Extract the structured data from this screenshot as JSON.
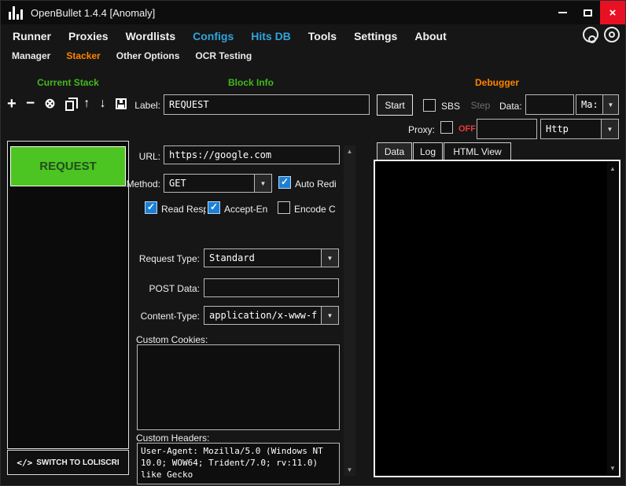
{
  "colors": {
    "accent_blue": "#2fa4dc",
    "accent_orange": "#ff8400",
    "accent_green": "#43b81e",
    "block_green": "#4cc421",
    "check_blue": "#1d7fd4",
    "off_red": "#eb3b3b",
    "close_red": "#e81123"
  },
  "icons": {
    "close": "×",
    "caret_down": "▼",
    "scroll_up": "▲",
    "scroll_down": "▼",
    "plus": "+",
    "minus": "−",
    "clear": "⊗",
    "up": "↑",
    "down": "↓"
  },
  "window": {
    "title": "OpenBullet 1.4.4 [Anomaly]"
  },
  "menu": {
    "items": [
      {
        "label": "Runner"
      },
      {
        "label": "Proxies"
      },
      {
        "label": "Wordlists"
      },
      {
        "label": "Configs"
      },
      {
        "label": "Hits DB"
      },
      {
        "label": "Tools"
      },
      {
        "label": "Settings"
      },
      {
        "label": "About"
      }
    ]
  },
  "submenu": {
    "items": [
      {
        "label": "Manager"
      },
      {
        "label": "Stacker"
      },
      {
        "label": "Other Options"
      },
      {
        "label": "OCR Testing"
      }
    ]
  },
  "stack": {
    "title": "Current Stack",
    "block_label": "REQUEST",
    "switch_icon": "</>",
    "switch_label": "SWITCH TO LOLISCRI"
  },
  "block_info": {
    "title": "Block Info",
    "label_field": {
      "label": "Label:",
      "value": "REQUEST"
    },
    "url": {
      "label": "URL:",
      "value": "https://google.com"
    },
    "method": {
      "label": "Method:",
      "value": "GET"
    },
    "auto_redirect": {
      "label": "Auto Redi",
      "checked": true
    },
    "read_response": {
      "label": "Read Resp",
      "checked": true
    },
    "accept_encoding": {
      "label": "Accept-En",
      "checked": true
    },
    "encode_content": {
      "label": "Encode C",
      "checked": false
    },
    "request_type": {
      "label": "Request Type:",
      "value": "Standard"
    },
    "post_data": {
      "label": "POST Data:",
      "value": ""
    },
    "content_type": {
      "label": "Content-Type:",
      "value": "application/x-www-f"
    },
    "custom_cookies": {
      "label": "Custom Cookies:",
      "value": ""
    },
    "custom_headers": {
      "label": "Custom Headers:",
      "value": "User-Agent: Mozilla/5.0 (Windows NT 10.0; WOW64; Trident/7.0; rv:11.0) like Gecko"
    }
  },
  "debugger": {
    "title": "Debugger",
    "start": "Start",
    "sbs": "SBS",
    "step": "Step",
    "data_label": "Data:",
    "data_value": "",
    "data_mode": "Ma:",
    "proxy_label": "Proxy:",
    "proxy_off": "OFF",
    "proxy_value": "",
    "proxy_type": "Http",
    "tabs": [
      {
        "label": "Data"
      },
      {
        "label": "Log"
      },
      {
        "label": "HTML View"
      }
    ]
  }
}
